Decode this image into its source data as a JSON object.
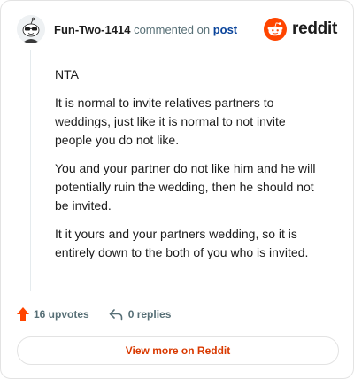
{
  "header": {
    "username": "Fun-Two-1414",
    "action_text": "commented on",
    "post_link": "post",
    "brand_name": "reddit",
    "brand_color": "#ff4500"
  },
  "comment": {
    "paragraphs": [
      "NTA",
      "It is normal to invite relatives partners to weddings, just like it is normal to not invite people you do not like.",
      "You and your partner do not like him and he will potentially ruin the wedding, then he should not be invited.",
      "It it yours and your partners wedding, so it is entirely down to the both of you who is invited."
    ]
  },
  "actions": {
    "upvotes_label": "16 upvotes",
    "replies_label": "0 replies",
    "upvote_color": "#ff4500"
  },
  "footer": {
    "view_more_label": "View more on Reddit",
    "accent": "#d93900"
  }
}
